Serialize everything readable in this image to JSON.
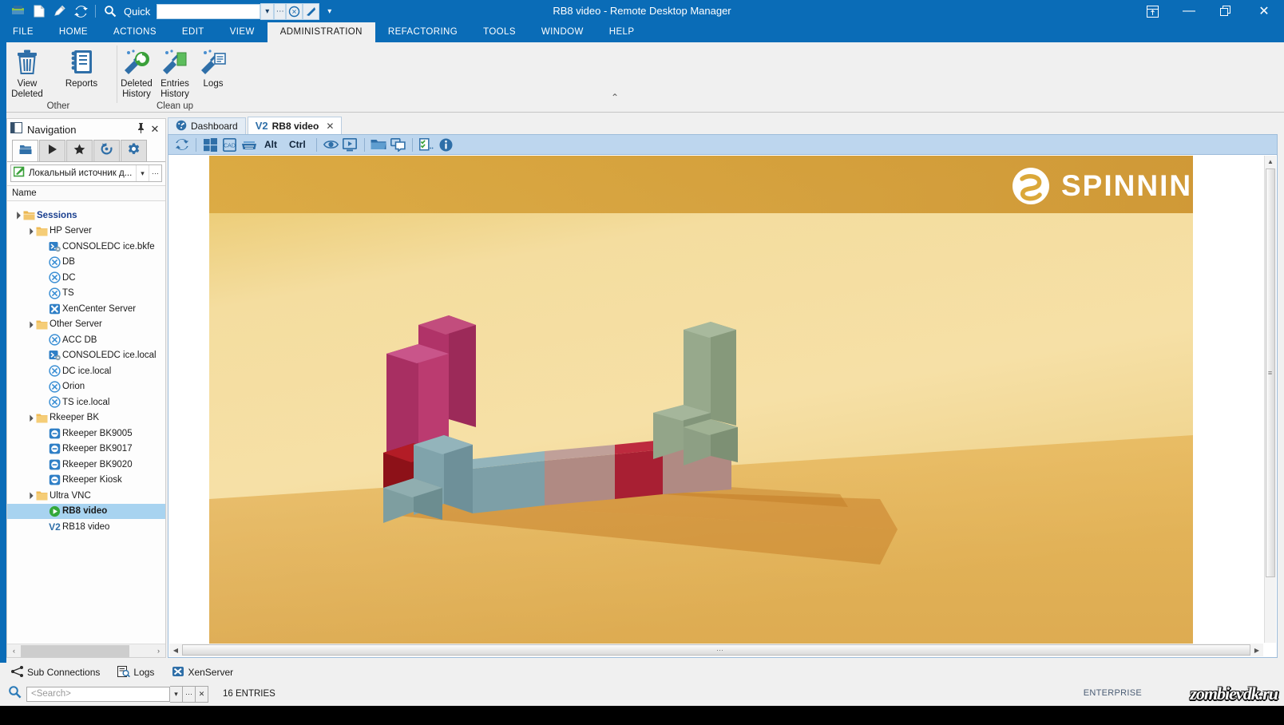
{
  "window": {
    "title": "RB8 video - Remote Desktop Manager",
    "quick_label": "Quick",
    "quick_value": "",
    "quick_placeholder": "",
    "controls": {
      "layout": "layout-icon",
      "minimize": "—",
      "restore": "restore-icon",
      "close": "✕",
      "fullscreen": "fullscreen-icon",
      "more": "▾"
    }
  },
  "ribbon": {
    "tabs": [
      {
        "label": "FILE",
        "active": false
      },
      {
        "label": "HOME",
        "active": false
      },
      {
        "label": "ACTIONS",
        "active": false
      },
      {
        "label": "EDIT",
        "active": false
      },
      {
        "label": "VIEW",
        "active": false
      },
      {
        "label": "ADMINISTRATION",
        "active": true
      },
      {
        "label": "REFACTORING",
        "active": false
      },
      {
        "label": "TOOLS",
        "active": false
      },
      {
        "label": "WINDOW",
        "active": false
      },
      {
        "label": "HELP",
        "active": false
      }
    ],
    "groups": [
      {
        "title": "Other",
        "buttons": [
          {
            "label": "View Deleted",
            "icon": "trash-icon"
          },
          {
            "label": "Reports",
            "icon": "report-book-icon"
          }
        ]
      },
      {
        "title": "Clean up",
        "buttons": [
          {
            "label": "Deleted History",
            "icon": "broom-restore-icon"
          },
          {
            "label": "Entries History",
            "icon": "broom-entries-icon"
          },
          {
            "label": "Logs",
            "icon": "broom-logs-icon"
          }
        ]
      }
    ],
    "collapse": "⌃"
  },
  "navigation": {
    "title": "Navigation",
    "pin": "pin-icon",
    "close": "✕",
    "tabs": [
      {
        "name": "sessions-tab",
        "icon": "folders-icon",
        "active": true
      },
      {
        "name": "running-tab",
        "icon": "play-icon",
        "active": false
      },
      {
        "name": "favorites-tab",
        "icon": "star-icon",
        "active": false
      },
      {
        "name": "recent-tab",
        "icon": "history-icon",
        "active": false
      },
      {
        "name": "settings-tab",
        "icon": "gear-icon",
        "active": false
      }
    ],
    "data_source": "Локальный источник д...",
    "data_source_dropdown": "▾",
    "data_source_more": "⋯",
    "column_header": "Name",
    "tree": [
      {
        "label": "Sessions",
        "depth": 0,
        "icon": "folder-sessions-icon",
        "expander": "▲",
        "root": true,
        "selected": false
      },
      {
        "label": "HP Server",
        "depth": 1,
        "icon": "folder-icon",
        "expander": "▲",
        "root": false,
        "selected": false
      },
      {
        "label": "CONSOLEDC ice.bkfe",
        "depth": 2,
        "icon": "console-icon",
        "expander": "",
        "root": false,
        "selected": false
      },
      {
        "label": "DB",
        "depth": 2,
        "icon": "rdp-circle-icon",
        "expander": "",
        "root": false,
        "selected": false
      },
      {
        "label": "DC",
        "depth": 2,
        "icon": "rdp-circle-icon",
        "expander": "",
        "root": false,
        "selected": false
      },
      {
        "label": "TS",
        "depth": 2,
        "icon": "rdp-circle-icon",
        "expander": "",
        "root": false,
        "selected": false
      },
      {
        "label": "XenCenter Server",
        "depth": 2,
        "icon": "xenserver-icon",
        "expander": "",
        "root": false,
        "selected": false
      },
      {
        "label": "Other Server",
        "depth": 1,
        "icon": "folder-icon",
        "expander": "▲",
        "root": false,
        "selected": false
      },
      {
        "label": "ACC DB",
        "depth": 2,
        "icon": "rdp-circle-icon",
        "expander": "",
        "root": false,
        "selected": false
      },
      {
        "label": "CONSOLEDC ice.local",
        "depth": 2,
        "icon": "console-icon",
        "expander": "",
        "root": false,
        "selected": false
      },
      {
        "label": "DC ice.local",
        "depth": 2,
        "icon": "rdp-circle-icon",
        "expander": "",
        "root": false,
        "selected": false
      },
      {
        "label": "Orion",
        "depth": 2,
        "icon": "rdp-circle-icon",
        "expander": "",
        "root": false,
        "selected": false
      },
      {
        "label": "TS ice.local",
        "depth": 2,
        "icon": "rdp-circle-icon",
        "expander": "",
        "root": false,
        "selected": false
      },
      {
        "label": "Rkeeper BK",
        "depth": 1,
        "icon": "folder-icon",
        "expander": "▲",
        "root": false,
        "selected": false
      },
      {
        "label": "Rkeeper BK9005",
        "depth": 2,
        "icon": "vnc-square-icon",
        "expander": "",
        "root": false,
        "selected": false
      },
      {
        "label": "Rkeeper BK9017",
        "depth": 2,
        "icon": "vnc-square-icon",
        "expander": "",
        "root": false,
        "selected": false
      },
      {
        "label": "Rkeeper BK9020",
        "depth": 2,
        "icon": "vnc-square-icon",
        "expander": "",
        "root": false,
        "selected": false
      },
      {
        "label": "Rkeeper Kiosk",
        "depth": 2,
        "icon": "vnc-square-icon",
        "expander": "",
        "root": false,
        "selected": false
      },
      {
        "label": "Ultra VNC",
        "depth": 1,
        "icon": "folder-icon",
        "expander": "▲",
        "root": false,
        "selected": false
      },
      {
        "label": "RB8 video",
        "depth": 2,
        "icon": "play-green-icon",
        "expander": "",
        "root": false,
        "selected": true
      },
      {
        "label": "RB18 video",
        "depth": 2,
        "icon": "v2-icon",
        "expander": "",
        "root": false,
        "selected": false
      }
    ],
    "hscroll_left": "‹",
    "hscroll_right": "›"
  },
  "document": {
    "tabs": [
      {
        "label": "Dashboard",
        "icon": "dashboard-icon",
        "active": false,
        "closable": false
      },
      {
        "label": "RB8 video",
        "icon": "v2-icon",
        "active": true,
        "closable": true,
        "close": "✕"
      }
    ],
    "toolbar": [
      {
        "name": "refresh-button",
        "icon": "refresh-icon",
        "type": "icon"
      },
      {
        "name": "separator-1",
        "type": "sep"
      },
      {
        "name": "start-menu-button",
        "icon": "windows-icon",
        "type": "icon"
      },
      {
        "name": "ctrl-alt-del-button",
        "icon": "cad-icon",
        "type": "icon"
      },
      {
        "name": "keyboard-button",
        "icon": "keyboard-icon",
        "type": "icon"
      },
      {
        "name": "alt-key-button",
        "label": "Alt",
        "type": "text"
      },
      {
        "name": "ctrl-key-button",
        "label": "Ctrl",
        "type": "text"
      },
      {
        "name": "separator-2",
        "type": "sep"
      },
      {
        "name": "view-only-button",
        "icon": "eye-icon",
        "type": "icon"
      },
      {
        "name": "screen-button",
        "icon": "monitor-play-icon",
        "type": "icon"
      },
      {
        "name": "separator-3",
        "type": "sep"
      },
      {
        "name": "file-transfer-button",
        "icon": "folder-open-icon",
        "type": "icon"
      },
      {
        "name": "chat-button",
        "icon": "chat-icon",
        "type": "icon"
      },
      {
        "name": "separator-4",
        "type": "sep"
      },
      {
        "name": "checklist-button",
        "icon": "checklist-icon",
        "type": "icon"
      },
      {
        "name": "info-button",
        "icon": "info-icon",
        "type": "icon"
      }
    ],
    "remote_screen": {
      "brand": "SPINNIN’ TV",
      "brand_logo": "spinnin-s-icon",
      "background_colors": [
        "#f5dd9a",
        "#e5b34d",
        "#d79c34"
      ]
    },
    "vscroll": {
      "up": "▲",
      "down": "▼",
      "grip": "≡"
    },
    "hscroll": {
      "left": "◀",
      "right": "▶",
      "grip": "⋯"
    }
  },
  "statusbar": {
    "items": [
      {
        "label": "Sub Connections",
        "icon": "sub-connections-icon"
      },
      {
        "label": "Logs",
        "icon": "logs-icon"
      },
      {
        "label": "XenServer",
        "icon": "xenserver-icon"
      }
    ],
    "search_placeholder": "<Search>",
    "search_value": "",
    "search_icon": "search-icon",
    "search_dropdown": "▾",
    "search_more": "⋯",
    "search_clear": "✕",
    "entries": "16 ENTRIES",
    "edition": "ENTERPRISE",
    "watermark": "zombievdk.ru"
  },
  "colors": {
    "accent": "#0a6cb7",
    "toolbar": "#bdd6ee",
    "selection": "#a8d3f0",
    "root_text": "#1a3f8f"
  }
}
